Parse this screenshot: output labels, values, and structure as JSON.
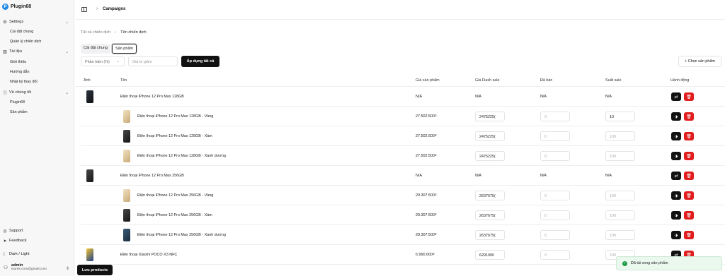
{
  "app": {
    "name": "Plugin68",
    "logo_letter": "P"
  },
  "sidebar": {
    "sections": [
      {
        "label": "Settings",
        "icon": "gear-icon",
        "items": [
          "Cài đặt chung",
          "Quản lý chiến dịch"
        ]
      },
      {
        "label": "Tài liệu",
        "icon": "book-icon",
        "items": [
          "Giới thiệu",
          "Hướng dẫn",
          "Nhật ký thay đổi"
        ]
      },
      {
        "label": "Về chúng tôi",
        "icon": "info-icon",
        "items": [
          "Plugin68",
          "Sản phẩm"
        ]
      }
    ],
    "footer": {
      "support": "Support",
      "feedback": "Feedback",
      "theme": "Dark / Light"
    },
    "user": {
      "name": "admin",
      "email": "isures.com@gmail.com"
    }
  },
  "header": {
    "breadcrumb": "Campaigns"
  },
  "sub_breadcrumb": {
    "parent": "Tất cả chiến dịch",
    "current": "Tên chiến dịch"
  },
  "tabs": [
    "Cài đặt chung",
    "Sản phẩm"
  ],
  "toolbar": {
    "discount_type": "Phần trăm (%)",
    "discount_placeholder": "Giá trị giảm",
    "apply_label": "Áp dụng tất cả",
    "choose_label": "+ Chọn sản phẩm"
  },
  "table": {
    "headers": [
      "Ảnh",
      "Tên",
      "Giá sản phẩm",
      "Giá Flash sale",
      "Đã bán",
      "Suất sale",
      "Hành động"
    ],
    "rows": [
      {
        "type": "parent",
        "name": "Điện thoại iPhone 12 Pro Max 128GB",
        "price": "N/A",
        "flash": "N/A",
        "sold": "N/A",
        "slots": "N/A",
        "thumb": "g"
      },
      {
        "type": "child",
        "name": "Điện thoại iPhone 12 Pro Max 128GB - Vàng",
        "price": "27.502.500₫",
        "flash": "2475225(",
        "sold": "0",
        "slots": "10",
        "thumb": "gold"
      },
      {
        "type": "child",
        "name": "Điện thoại iPhone 12 Pro Max 128GB - Xám",
        "price": "27.502.500₫",
        "flash": "2475225(",
        "sold": "0",
        "slots": "100",
        "thumb": "dark"
      },
      {
        "type": "child",
        "name": "Điện thoại iPhone 12 Pro Max 128GB - Xanh dương",
        "price": "27.502.500₫",
        "flash": "2475225(",
        "sold": "0",
        "slots": "100",
        "thumb": "gold"
      },
      {
        "type": "parent",
        "name": "Điện thoại iPhone 12 Pro Max 256GB",
        "price": "N/A",
        "flash": "N/A",
        "sold": "N/A",
        "slots": "N/A",
        "thumb": "dark"
      },
      {
        "type": "child",
        "name": "Điện thoại iPhone 12 Pro Max 256GB - Vàng",
        "price": "29.307.500₫",
        "flash": "2637675(",
        "sold": "0",
        "slots": "100",
        "thumb": "gold"
      },
      {
        "type": "child",
        "name": "Điện thoại iPhone 12 Pro Max 256GB - Xám",
        "price": "29.307.500₫",
        "flash": "2637675(",
        "sold": "0",
        "slots": "100",
        "thumb": "dark"
      },
      {
        "type": "child",
        "name": "Điện thoại iPhone 12 Pro Max 256GB - Xanh dương",
        "price": "29.307.500₫",
        "flash": "2637675(",
        "sold": "0",
        "slots": "100",
        "thumb": "blue"
      },
      {
        "type": "parent",
        "name": "Điện thoại Xiaomi POCO X3 NFC",
        "price": "6.990.000₫",
        "flash": "6291000",
        "sold": "0",
        "slots": "100",
        "thumb": "poco"
      }
    ]
  },
  "toast": "Đã tải xong sản phẩm",
  "save_label": "Lưu products"
}
